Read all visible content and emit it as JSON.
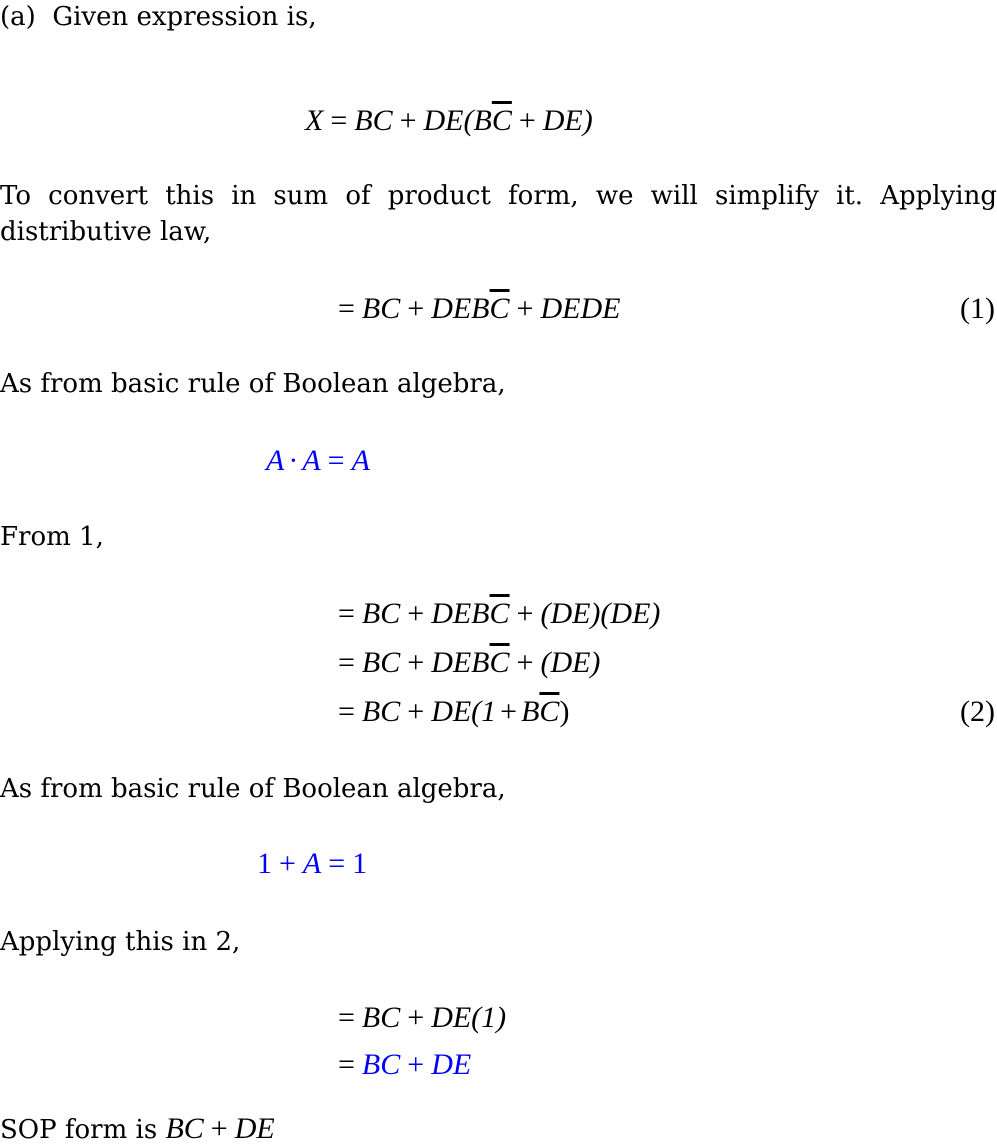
{
  "colors": {
    "text": "#000000",
    "highlight": "#0000ff"
  },
  "intro": {
    "label": "(a)",
    "text": "Given expression is,"
  },
  "given": {
    "lhs": "X",
    "eq": "=",
    "t1": "BC",
    "plus1": "+",
    "t2": "DE(B",
    "t2_bar": "C",
    "plus2": "+",
    "t3": "DE)"
  },
  "para1": "To convert this in sum of product form, we will simplify it.  Applying distributive law,",
  "eq1": {
    "eq": "=",
    "t1": "BC",
    "plus1": "+",
    "t2": "DEB",
    "t2_bar": "C",
    "plus2": "+",
    "t3": "DEDE",
    "number": "(1)"
  },
  "rule1_intro": "As from basic rule of Boolean algebra,",
  "rule1": {
    "a": "A",
    "dot": "·",
    "b": "A",
    "eq": "=",
    "c": "A"
  },
  "from1": "From 1,",
  "eq2": {
    "line1": {
      "eq": "=",
      "t1": "BC",
      "plus1": "+",
      "t2": "DEB",
      "t2_bar": "C",
      "plus2": "+",
      "t3": "(DE)(DE)"
    },
    "line2": {
      "eq": "=",
      "t1": "BC",
      "plus1": "+",
      "t2": "DEB",
      "t2_bar": "C",
      "plus2": "+",
      "t3": "(DE)"
    },
    "line3": {
      "eq": "=",
      "t1": "BC",
      "plus1": "+",
      "t2": "DE(1",
      "plus2": "+",
      "t3": "B",
      "t3_bar": "C",
      "close": ")"
    },
    "number": "(2)"
  },
  "rule2_intro": "As from basic rule of Boolean algebra,",
  "rule2": {
    "a": "1",
    "plus": "+",
    "b": "A",
    "eq": "=",
    "c": "1"
  },
  "apply2": "Applying this in 2,",
  "eq3": {
    "line1": {
      "eq": "=",
      "t1": "BC",
      "plus": "+",
      "t2": "DE(1)"
    },
    "line2": {
      "eq": "=",
      "t1": "BC",
      "plus": "+",
      "t2": "DE"
    }
  },
  "conclusion": {
    "text": "SOP form is",
    "t1": "BC",
    "plus": "+",
    "t2": "DE"
  }
}
